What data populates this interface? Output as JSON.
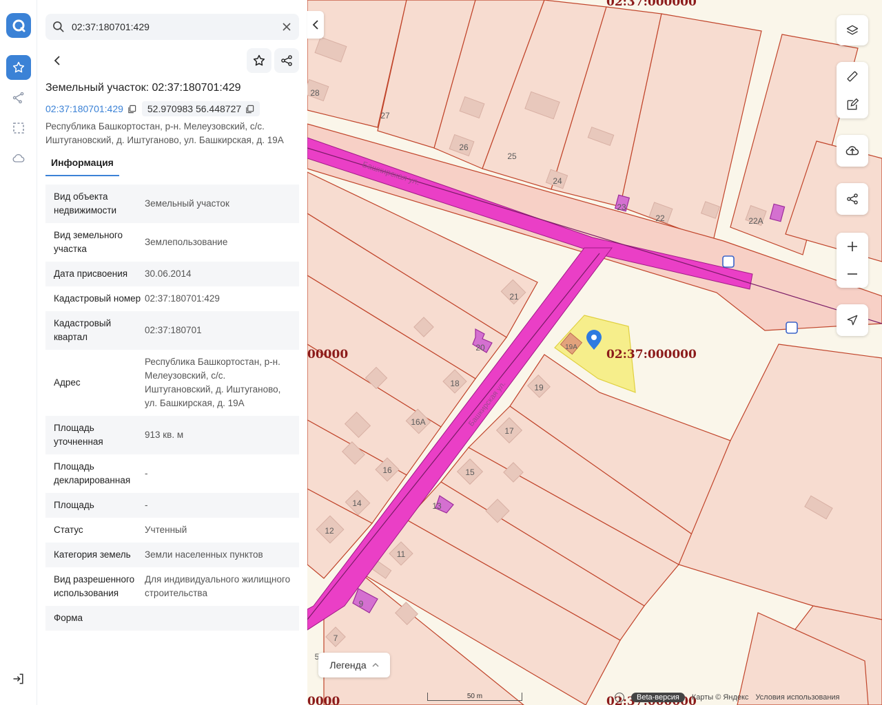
{
  "search": {
    "value": "02:37:180701:429",
    "placeholder": ""
  },
  "object": {
    "title": "Земельный участок: 02:37:180701:429",
    "cad_number_link": "02:37:180701:429",
    "coordinates": "52.970983 56.448727",
    "address": "Республика Башкортостан, р-н. Мелеузовский, с/с. Иштугановский, д. Иштуганово, ул. Башкирская, д. 19А"
  },
  "tabs": [
    {
      "label": "Информация"
    }
  ],
  "properties": [
    {
      "label": "Вид объекта недвижимости",
      "value": "Земельный участок"
    },
    {
      "label": "Вид земельного участка",
      "value": "Землепользование"
    },
    {
      "label": "Дата присвоения",
      "value": "30.06.2014"
    },
    {
      "label": "Кадастровый номер",
      "value": "02:37:180701:429"
    },
    {
      "label": "Кадастровый квартал",
      "value": "02:37:180701"
    },
    {
      "label": "Адрес",
      "value": "Республика Башкортостан, р-н. Мелеузовский, с/с. Иштугановский, д. Иштуганово, ул. Башкирская, д. 19А"
    },
    {
      "label": "Площадь уточненная",
      "value": "913 кв. м"
    },
    {
      "label": "Площадь декларированная",
      "value": "-"
    },
    {
      "label": "Площадь",
      "value": "-"
    },
    {
      "label": "Статус",
      "value": "Учтенный"
    },
    {
      "label": "Категория земель",
      "value": "Земли населенных пунктов"
    },
    {
      "label": "Вид разрешенного использования",
      "value": "Для индивидуального жилищного строительства"
    },
    {
      "label": "Форма",
      "value": ""
    }
  ],
  "map": {
    "quarter_labels": [
      "02:37:000000",
      "00000",
      "02:37:000000",
      "0000",
      "02:37:000000"
    ],
    "street_labels": [
      "Башкирская ул.",
      "Башкирская ул."
    ],
    "house_numbers": [
      "28",
      "27",
      "26",
      "25",
      "24",
      "23",
      "22",
      "22А",
      "21",
      "20",
      "19",
      "18",
      "17",
      "16А",
      "16",
      "15",
      "14",
      "13",
      "12",
      "11",
      "9",
      "7",
      "5",
      "19А"
    ],
    "legend_label": "Легенда",
    "scale_label": "50 m",
    "beta_label": "Beta-версия",
    "copyright": "Карты © Яндекс",
    "terms": "Условия использования"
  },
  "colors": {
    "accent": "#3b82d6",
    "parcel_fill": "#f7dcd0",
    "parcel_stroke": "#c0442a",
    "road_magenta": "#ea3fc6",
    "selected_parcel": "#f5ec7a",
    "quarter_label": "#8b0000"
  },
  "icons": {
    "logo": "app-logo-icon",
    "favorites": "star-icon",
    "route": "route-icon",
    "select_area": "dashed-square-icon",
    "cloud": "cloud-icon",
    "logout": "logout-icon"
  }
}
